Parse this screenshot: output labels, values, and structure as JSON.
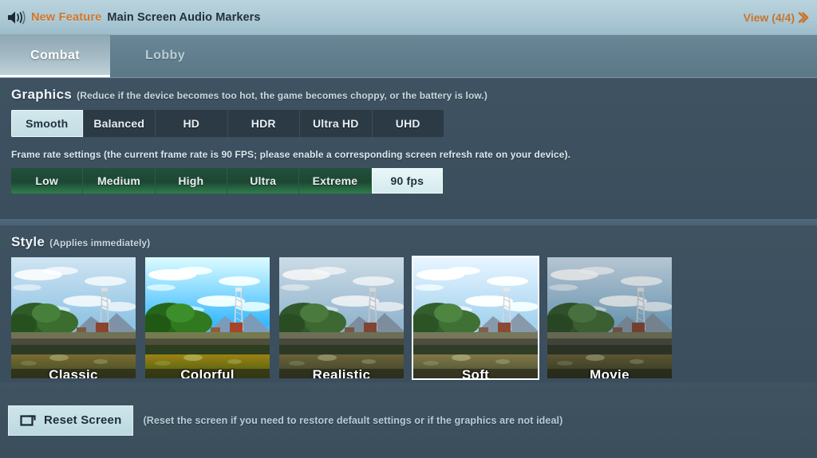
{
  "notice": {
    "speaker_icon": "speaker-icon",
    "badge": "New Feature",
    "text": "Main Screen Audio Markers",
    "view_label": "View (4/4)",
    "chevron_icon": "chevron-right-icon"
  },
  "tabs": [
    {
      "label": "Combat",
      "active": true
    },
    {
      "label": "Lobby",
      "active": false
    }
  ],
  "graphics": {
    "title": "Graphics",
    "subtitle": "(Reduce if the device becomes too hot, the game becomes choppy, or the battery is low.)",
    "options": [
      {
        "label": "Smooth",
        "selected": true
      },
      {
        "label": "Balanced",
        "selected": false
      },
      {
        "label": "HD",
        "selected": false
      },
      {
        "label": "HDR",
        "selected": false
      },
      {
        "label": "Ultra HD",
        "selected": false
      },
      {
        "label": "UHD",
        "selected": false
      }
    ]
  },
  "frame_rate": {
    "note": "Frame rate settings (the current frame rate is 90 FPS; please enable a corresponding screen refresh rate on your device).",
    "options": [
      {
        "label": "Low",
        "selected": false
      },
      {
        "label": "Medium",
        "selected": false
      },
      {
        "label": "High",
        "selected": false
      },
      {
        "label": "Ultra",
        "selected": false
      },
      {
        "label": "Extreme",
        "selected": false
      },
      {
        "label": "90 fps",
        "selected": true
      }
    ]
  },
  "style": {
    "title": "Style",
    "subtitle": "(Applies immediately)",
    "items": [
      {
        "label": "Classic",
        "selected": false,
        "sky_top": "#cfe4f2",
        "sky_bottom": "#8fc3e4",
        "ground": "#7a6a32",
        "field": "#3d4a24",
        "saturation": 1.0,
        "brightness": 1.0
      },
      {
        "label": "Colorful",
        "selected": false,
        "sky_top": "#d6ecf8",
        "sky_bottom": "#4fa8e0",
        "ground": "#8d7a2c",
        "field": "#3f5220",
        "saturation": 1.35,
        "brightness": 1.06
      },
      {
        "label": "Realistic",
        "selected": false,
        "sky_top": "#cfe2ee",
        "sky_bottom": "#93bcd8",
        "ground": "#6f6434",
        "field": "#39452a",
        "saturation": 0.88,
        "brightness": 0.97
      },
      {
        "label": "Soft",
        "selected": true,
        "sky_top": "#dbeaf5",
        "sky_bottom": "#9ac9e6",
        "ground": "#7d7140",
        "field": "#3f4b2c",
        "saturation": 0.92,
        "brightness": 1.05
      },
      {
        "label": "Movie",
        "selected": false,
        "sky_top": "#c6dced",
        "sky_bottom": "#6fa9cf",
        "ground": "#6a5e30",
        "field": "#323d22",
        "saturation": 0.8,
        "brightness": 0.9
      }
    ]
  },
  "bottom": {
    "reset_icon": "reset-screen-icon",
    "reset_label": "Reset Screen",
    "reset_note": "(Reset the screen if you need to restore default settings or if the graphics are not ideal)"
  },
  "colors": {
    "accent_orange": "#d2762a",
    "selected_light": "#cde5ea",
    "fps_green": "#2f7f4c",
    "selection_corner": "#e8c23a",
    "panel_bg": "#3d505e"
  }
}
